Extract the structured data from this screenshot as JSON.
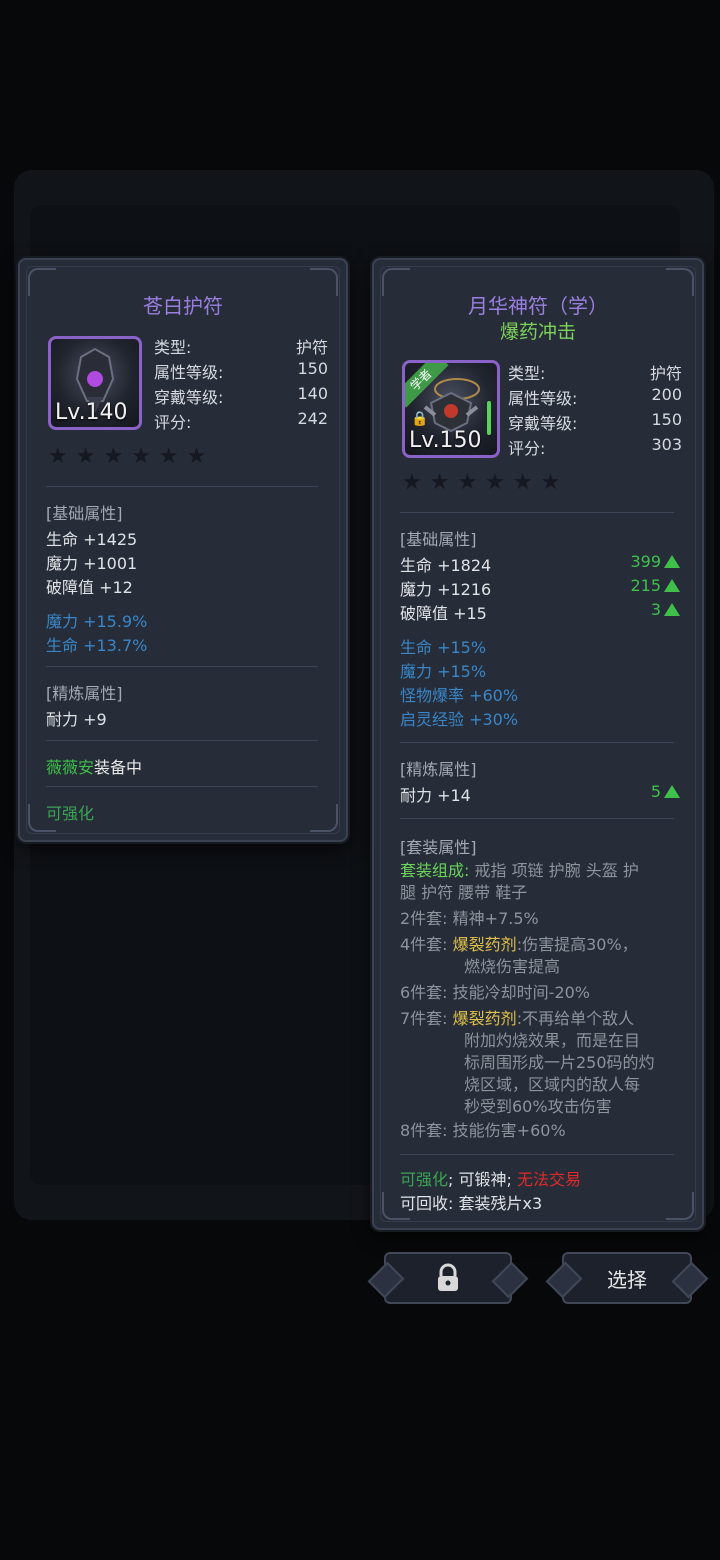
{
  "left_card": {
    "title": "苍白护符",
    "level": "Lv.140",
    "info": [
      {
        "label": "类型:",
        "value": "护符"
      },
      {
        "label": "属性等级:",
        "value": "150"
      },
      {
        "label": "穿戴等级:",
        "value": "140"
      },
      {
        "label": "评分:",
        "value": "242"
      }
    ],
    "stars": "★★★★★★",
    "base_header": "[基础属性]",
    "base_stats": [
      "生命 +1425",
      "魔力 +1001",
      "破障值 +12"
    ],
    "extra_stats": [
      "魔力 +15.9%",
      "生命 +13.7%"
    ],
    "refine_header": "[精炼属性]",
    "refine_stats": [
      "耐力 +9"
    ],
    "equipped_name": "薇薇安",
    "equipped_suffix": "装备中",
    "enhanceable": "可强化"
  },
  "right_card": {
    "title": "月华神符（学）",
    "subtitle": "爆药冲击",
    "ribbon": "学者",
    "level": "Lv.150",
    "info": [
      {
        "label": "类型:",
        "value": "护符"
      },
      {
        "label": "属性等级:",
        "value": "200"
      },
      {
        "label": "穿戴等级:",
        "value": "150"
      },
      {
        "label": "评分:",
        "value": "303"
      }
    ],
    "stars": "★★★★★★",
    "base_header": "[基础属性]",
    "base_stats": [
      {
        "text": "生命 +1824",
        "delta": "399"
      },
      {
        "text": "魔力 +1216",
        "delta": "215"
      },
      {
        "text": "破障值 +15",
        "delta": "3"
      }
    ],
    "extra_stats": [
      "生命 +15%",
      "魔力 +15%",
      "怪物爆率 +60%",
      "启灵经验 +30%"
    ],
    "refine_header": "[精炼属性]",
    "refine_stats": [
      {
        "text": "耐力 +14",
        "delta": "5"
      }
    ],
    "set_header": "[套装属性]",
    "set_label": "套装组成:",
    "set_items": "戒指 项链 护腕 头盔 护",
    "set_items2": "腿 护符 腰带 鞋子",
    "set_bonuses": {
      "b2_label": "2件套:",
      "b2_text": "精神+7.5%",
      "b4_label": "4件套:",
      "b4_name": "爆裂药剂",
      "b4_text": ":伤害提高30%，",
      "b4_text2": "燃烧伤害提高",
      "b6_label": "6件套:",
      "b6_text": "技能冷却时间-20%",
      "b7_label": "7件套:",
      "b7_name": "爆裂药剂",
      "b7_text": ":不再给单个敌人",
      "b7_l2": "附加灼烧效果，而是在目",
      "b7_l3": "标周围形成一片250码的灼",
      "b7_l4": "烧区域，区域内的敌人每",
      "b7_l5": "秒受到60%攻击伤害",
      "b8_label": "8件套:",
      "b8_text": "技能伤害+60%"
    },
    "flags": {
      "enhance": "可强化",
      "sep1": ";",
      "forge": "可锻神",
      "sep2": ";",
      "trade": "无法交易"
    },
    "recycle": "可回收: 套装残片x3"
  },
  "buttons": {
    "lock_icon": "lock-icon",
    "select": "选择"
  },
  "colors": {
    "title_purple": "#9b7fe0",
    "green": "#3fc04a",
    "blue": "#3a86c8",
    "yellow": "#e0c24a",
    "red": "#e02a2a"
  }
}
